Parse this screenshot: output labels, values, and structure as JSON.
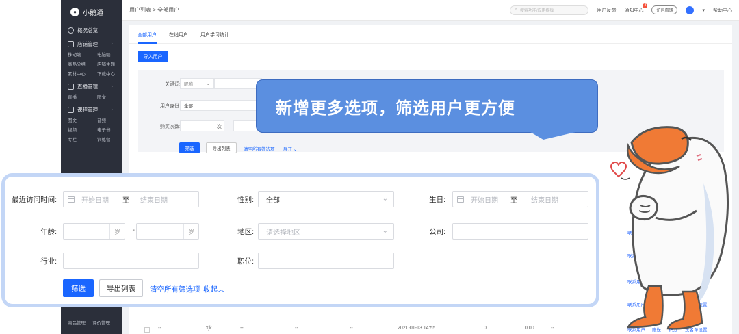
{
  "app": {
    "logo_text": "小鹅通",
    "breadcrumb": "用户列表 > 全部用户",
    "search_placeholder": "搜索功能/应用模板",
    "top_links": [
      "用户反馈",
      "通知中心",
      "访问店铺",
      "帮助中心"
    ],
    "notif_count": "8"
  },
  "sidebar": {
    "items": [
      {
        "label": "概况总览",
        "icon": "clock-icon",
        "subs": []
      },
      {
        "label": "店铺管理",
        "icon": "store-icon",
        "subs": [
          "移动端",
          "电脑端",
          "商品分组",
          "店铺主题",
          "素材中心",
          "下载中心"
        ]
      },
      {
        "label": "直播管理",
        "icon": "camera-icon",
        "subs": [
          "直播",
          "图文"
        ]
      },
      {
        "label": "课程管理",
        "icon": "book-icon",
        "subs": [
          "图文",
          "音频",
          "视频",
          "电子书",
          "专栏",
          "训练营"
        ]
      }
    ],
    "bottom": [
      "商品管理",
      "评价管理"
    ]
  },
  "tabs": [
    "全部用户",
    "在线用户",
    "用户学习统计"
  ],
  "import_button": "导入用户",
  "bg_filter": {
    "keyword_label": "关键词:",
    "keyword_select": "昵称",
    "identity_label": "用户身份:",
    "identity_value": "全部",
    "purchase_label": "购买次数:",
    "purchase_unit": "次",
    "filter_btn": "筛选",
    "export_btn": "导出列表",
    "clear_link": "清空所有筛选项",
    "expand_link": "展开"
  },
  "callout_text": "新增更多选项，筛选用户更方便",
  "zoom": {
    "last_visit_label": "最近访问时间:",
    "start_date_ph": "开始日期",
    "to_text": "至",
    "end_date_ph": "结束日期",
    "gender_label": "性别:",
    "gender_value": "全部",
    "birthday_label": "生日:",
    "age_label": "年龄:",
    "age_unit": "岁",
    "age_sep": "-",
    "region_label": "地区:",
    "region_ph": "请选择地区",
    "company_label": "公司:",
    "industry_label": "行业:",
    "position_label": "职位:",
    "filter_btn": "筛选",
    "export_btn": "导出列表",
    "clear_link": "清空所有筛选项",
    "collapse_link": "收起"
  },
  "table": {
    "row": {
      "name": "xjk",
      "dash": "--",
      "time": "2021-01-13 14:55",
      "count": "0",
      "amount": "0.00"
    },
    "actions": [
      "联系用户",
      "赠送",
      "积分",
      "黑名单设置"
    ],
    "partial_action": "联系用户"
  }
}
